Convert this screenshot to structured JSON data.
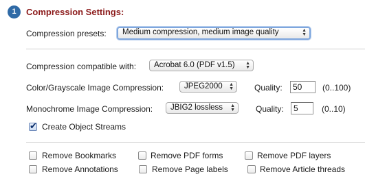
{
  "header": {
    "step_number": "1",
    "title": "Compression Settings:"
  },
  "presets": {
    "label": "Compression presets:",
    "selected": "Medium compression, medium image quality"
  },
  "compatibility": {
    "label": "Compression compatible with:",
    "selected": "Acrobat 6.0 (PDF v1.5)"
  },
  "color_compression": {
    "label": "Color/Grayscale Image Compression:",
    "selected": "JPEG2000",
    "quality_label": "Quality:",
    "quality_value": "50",
    "quality_range": "(0..100)"
  },
  "mono_compression": {
    "label": "Monochrome Image Compression:",
    "selected": "JBIG2 lossless",
    "quality_label": "Quality:",
    "quality_value": "5",
    "quality_range": "(0..10)"
  },
  "object_streams": {
    "label": "Create Object Streams",
    "checked": true
  },
  "remove_options": [
    {
      "label": "Remove Bookmarks",
      "checked": false
    },
    {
      "label": "Remove PDF forms",
      "checked": false
    },
    {
      "label": "Remove PDF layers",
      "checked": false
    },
    {
      "label": "Remove Annotations",
      "checked": false
    },
    {
      "label": "Remove Page labels",
      "checked": false
    },
    {
      "label": "Remove Article threads",
      "checked": false
    }
  ],
  "colors": {
    "badge": "#2f6aa6",
    "title": "#8b1a1a"
  }
}
